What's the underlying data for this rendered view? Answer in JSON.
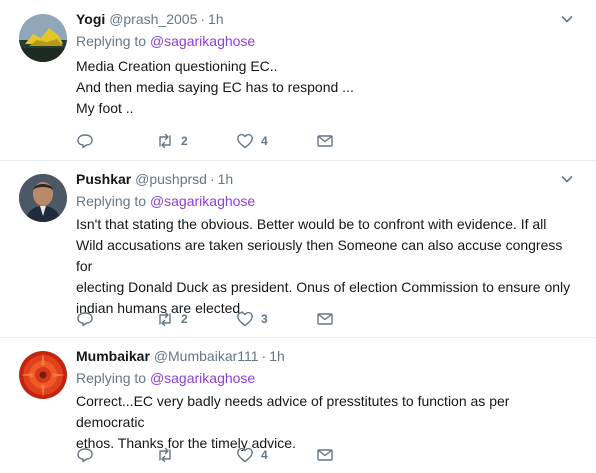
{
  "tweets": [
    {
      "name": "Yogi",
      "handle": "@prash_2005",
      "time": "1h",
      "replying_prefix": "Replying to",
      "replying_to": "@sagarikaghose",
      "lines": [
        "Media Creation questioning EC..",
        "And then media saying EC has to respond ...",
        "My foot .."
      ],
      "retweets": "2",
      "likes": "4"
    },
    {
      "name": "Pushkar",
      "handle": "@pushprsd",
      "time": "1h",
      "replying_prefix": "Replying to",
      "replying_to": "@sagarikaghose",
      "lines": [
        "Isn't that stating the obvious. Better would be to confront with evidence. If all",
        "Wild accusations are taken seriously then Someone can also accuse congress for",
        "electing Donald Duck as president. Onus of election Commission to ensure only",
        "indian humans are elected."
      ],
      "retweets": "2",
      "likes": "3"
    },
    {
      "name": "Mumbaikar",
      "handle": "@Mumbaikar111",
      "time": "1h",
      "replying_prefix": "Replying to",
      "replying_to": "@sagarikaghose",
      "lines": [
        "Correct...EC very badly needs advice of presstitutes to function as per democratic",
        "ethos. Thanks for the timely advice."
      ],
      "retweets": "",
      "likes": "4"
    }
  ],
  "icons": {
    "reply": "reply-icon",
    "retweet": "retweet-icon",
    "like": "heart-icon",
    "message": "envelope-icon",
    "caret": "chevron-down-icon"
  },
  "colors": {
    "text": "#14171a",
    "muted": "#657786",
    "mention": "#8c3fd4",
    "divider": "#e6ecf0"
  }
}
